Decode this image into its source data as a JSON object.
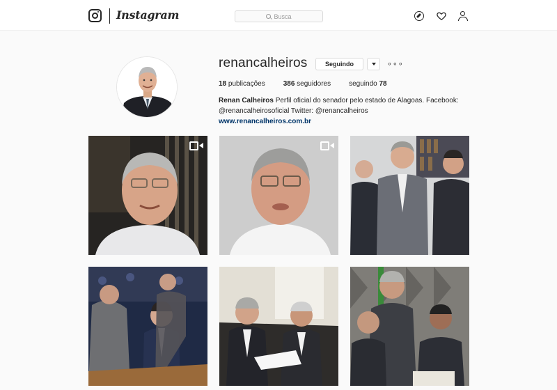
{
  "nav": {
    "wordmark": "Instagram",
    "search_placeholder": "Busca",
    "icons": [
      "instagram-logo-icon",
      "search-icon",
      "compass-icon",
      "heart-icon",
      "person-icon"
    ]
  },
  "profile": {
    "username": "renancalheiros",
    "follow_button": "Seguindo",
    "more": "∘∘∘",
    "stats": {
      "posts_count": "18",
      "posts_label": " publicações",
      "followers_count": "386",
      "followers_label": " seguidores",
      "following_label": "seguindo ",
      "following_count": "78"
    },
    "bio": {
      "full_name": "Renan Calheiros",
      "text": " Perfil oficial do senador pelo estado de Alagoas. Facebook: @renancalheirosoficial Twitter: @renancalheiros ",
      "link": "www.renancalheiros.com.br"
    }
  },
  "posts": [
    {
      "type": "video"
    },
    {
      "type": "video"
    },
    {
      "type": "photo"
    },
    {
      "type": "photo"
    },
    {
      "type": "photo"
    },
    {
      "type": "photo"
    }
  ],
  "colors": {
    "nav_bg": "#ffffff",
    "page_bg": "#fafafa",
    "text": "#262626",
    "link": "#003569",
    "border": "#dbdbdb"
  }
}
